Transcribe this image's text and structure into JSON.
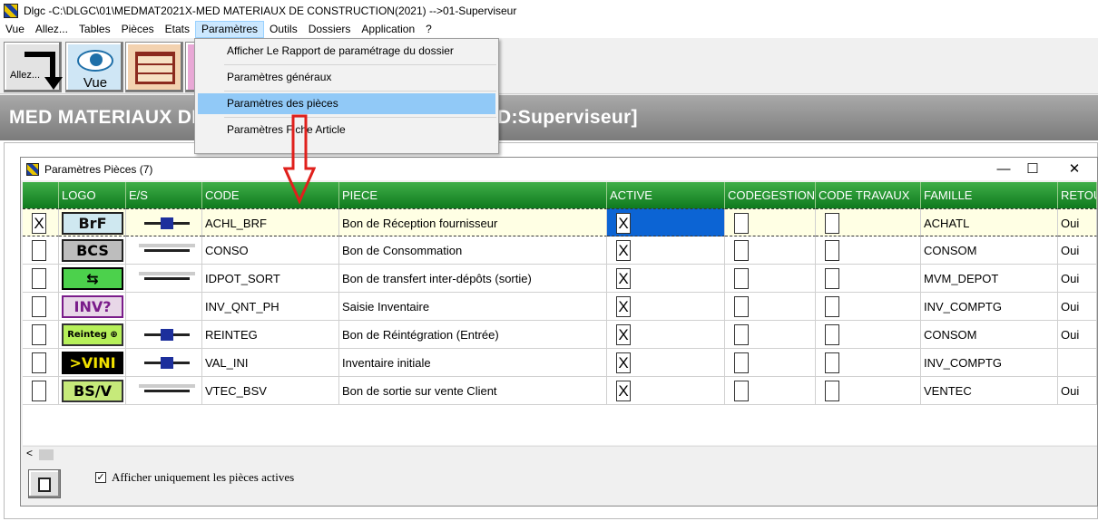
{
  "window": {
    "title": "Dlgc -C:\\DLGC\\01\\MEDMAT2021X-MED MATERIAUX DE CONSTRUCTION(2021) -->01-Superviseur"
  },
  "menubar": [
    "Vue",
    "Allez...",
    "Tables",
    "Pièces",
    "Etats",
    "Paramètres",
    "Outils",
    "Dossiers",
    "Application",
    "?"
  ],
  "menubar_active": "Paramètres",
  "toolbar": {
    "allez_label": "Allez...",
    "vue_label": "Vue"
  },
  "banner": {
    "left_text": "MED MATERIAUX DI",
    "right_text": "D:Superviseur]"
  },
  "dropdown": {
    "items": [
      "Afficher Le Rapport de paramétrage du dossier",
      "Paramètres généraux",
      "Paramètres des pièces",
      "Paramètres Fiche Article"
    ],
    "highlighted": "Paramètres des pièces"
  },
  "dialog": {
    "title": "Paramètres Pièces (7)",
    "minimize": "—",
    "maximize": "☐",
    "close": "✕",
    "columns": [
      "",
      "LOGO",
      "E/S",
      "CODE",
      "PIECE",
      "ACTIVE",
      "CODEGESTION",
      "CODE TRAVAUX",
      "FAMILLE",
      "RETOU"
    ],
    "rows": [
      {
        "sel": "X",
        "logo": "BrF",
        "code": "ACHL_BRF",
        "piece": "Bon de Réception fournisseur",
        "active": "X",
        "famille": "ACHATL",
        "retour": "Oui",
        "es": "entree"
      },
      {
        "sel": "",
        "logo": "BCS",
        "code": "CONSO",
        "piece": "Bon de Consommation",
        "active": "X",
        "famille": "CONSOM",
        "retour": "Oui",
        "es": "sortie"
      },
      {
        "sel": "",
        "logo": "⇆",
        "code": "IDPOT_SORT",
        "piece": "Bon de transfert inter-dépôts (sortie)",
        "active": "X",
        "famille": "MVM_DEPOT",
        "retour": "Oui",
        "es": "sortie"
      },
      {
        "sel": "",
        "logo": "INV?",
        "code": "INV_QNT_PH",
        "piece": "Saisie Inventaire",
        "active": "X",
        "famille": "INV_COMPTG",
        "retour": "Oui",
        "es": "none"
      },
      {
        "sel": "",
        "logo": "Reinteg ⊕",
        "code": "REINTEG",
        "piece": "Bon de Réintégration (Entrée)",
        "active": "X",
        "famille": "CONSOM",
        "retour": "Oui",
        "es": "entree"
      },
      {
        "sel": "",
        "logo": ">VINI",
        "code": "VAL_INI",
        "piece": "Inventaire initiale",
        "active": "X",
        "famille": "INV_COMPTG",
        "retour": "",
        "es": "entree"
      },
      {
        "sel": "",
        "logo": "BS/V",
        "code": "VTEC_BSV",
        "piece": "Bon de sortie sur vente Client",
        "active": "X",
        "famille": "VENTEC",
        "retour": "Oui",
        "es": "sortie"
      }
    ],
    "scroll_left": "<",
    "checkbox_mark": "✓",
    "only_active_label": "Afficher uniquement les pièces actives"
  },
  "colors": {
    "header_green": "#1d8a2c",
    "selection_blue": "#0c64d4",
    "menu_highlight": "#91c9f7"
  }
}
